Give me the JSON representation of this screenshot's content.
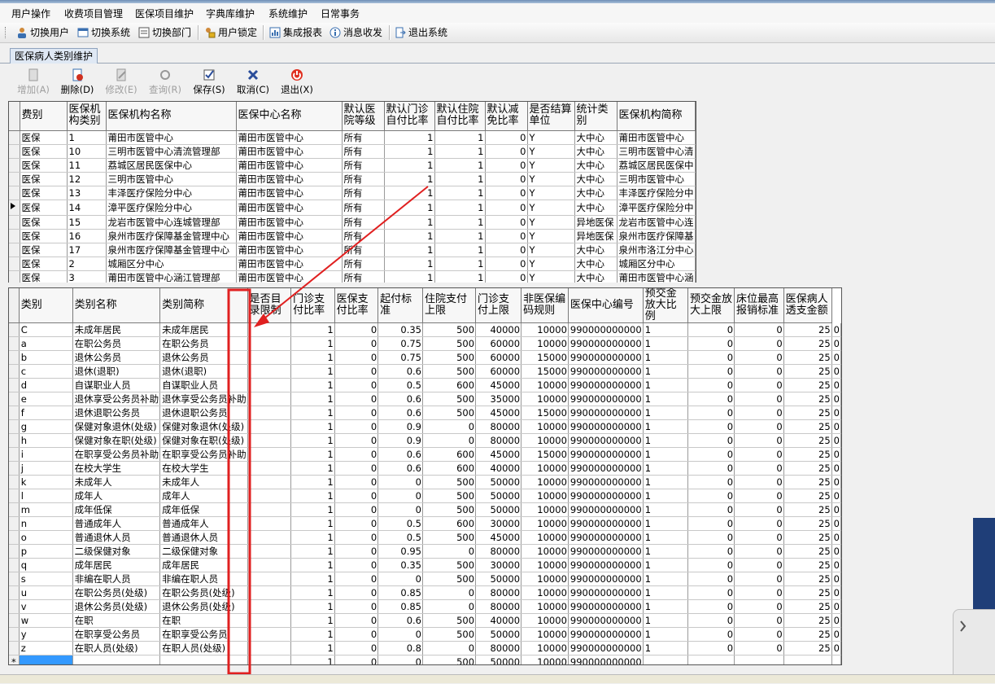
{
  "menu": [
    "用户操作",
    "收费项目管理",
    "医保项目维护",
    "字典库维护",
    "系统维护",
    "日常事务"
  ],
  "toolbar": {
    "switch_user": "切换用户",
    "switch_system": "切换系统",
    "switch_dept": "切换部门",
    "lock_user": "用户锁定",
    "reports": "集成报表",
    "messages": "消息收发",
    "exit_system": "退出系统"
  },
  "tab_title": "医保病人类别维护",
  "actions": {
    "add": "增加(A)",
    "delete": "删除(D)",
    "modify": "修改(E)",
    "query": "查询(R)",
    "save": "保存(S)",
    "cancel": "取消(C)",
    "exit": "退出(X)"
  },
  "grid1": {
    "headers": [
      "费别",
      "医保机构类别",
      "医保机构名称",
      "医保中心名称",
      "默认医院等级",
      "默认门诊自付比率",
      "默认住院自付比率",
      "默认减免比率",
      "是否结算单位",
      "统计类别",
      "医保机构简称"
    ],
    "rows": [
      [
        "医保",
        "1",
        "莆田市医管中心",
        "莆田市医管中心",
        "所有",
        "1",
        "1",
        "0",
        "Y",
        "大中心",
        "莆田市医管中心"
      ],
      [
        "医保",
        "10",
        "三明市医管中心清流管理部",
        "莆田市医管中心",
        "所有",
        "1",
        "1",
        "0",
        "Y",
        "大中心",
        "三明市医管中心清"
      ],
      [
        "医保",
        "11",
        "荔城区居民医保中心",
        "莆田市医管中心",
        "所有",
        "1",
        "1",
        "0",
        "Y",
        "大中心",
        "荔城区居民医保中"
      ],
      [
        "医保",
        "12",
        "三明市医管中心",
        "莆田市医管中心",
        "所有",
        "1",
        "1",
        "0",
        "Y",
        "大中心",
        "三明市医管中心"
      ],
      [
        "医保",
        "13",
        "丰泽医疗保险分中心",
        "莆田市医管中心",
        "所有",
        "1",
        "1",
        "0",
        "Y",
        "大中心",
        "丰泽医疗保险分中"
      ],
      [
        "医保",
        "14",
        "漳平医疗保险分中心",
        "莆田市医管中心",
        "所有",
        "1",
        "1",
        "0",
        "Y",
        "大中心",
        "漳平医疗保险分中"
      ],
      [
        "医保",
        "15",
        "龙岩市医管中心连城管理部",
        "莆田市医管中心",
        "所有",
        "1",
        "1",
        "0",
        "Y",
        "异地医保",
        "龙岩市医管中心连"
      ],
      [
        "医保",
        "16",
        "泉州市医疗保障基金管理中心",
        "莆田市医管中心",
        "所有",
        "1",
        "1",
        "0",
        "Y",
        "异地医保",
        "泉州市医疗保障基"
      ],
      [
        "医保",
        "17",
        "泉州市医疗保障基金管理中心",
        "莆田市医管中心",
        "所有",
        "1",
        "1",
        "0",
        "Y",
        "大中心",
        "泉州市洛江分中心"
      ],
      [
        "医保",
        "2",
        "城厢区分中心",
        "莆田市医管中心",
        "所有",
        "1",
        "1",
        "0",
        "Y",
        "大中心",
        "城厢区分中心"
      ],
      [
        "医保",
        "3",
        "莆田市医管中心涵江管理部",
        "莆田市医管中心",
        "所有",
        "1",
        "1",
        "0",
        "Y",
        "大中心",
        "莆田市医管中心涵"
      ]
    ],
    "current_row": 5
  },
  "grid2": {
    "headers": [
      "类别",
      "类别名称",
      "类别简称",
      "是否目录限制",
      "门诊支付比率",
      "医保支付比率",
      "起付标准",
      "住院支付上限",
      "门诊支付上限",
      "非医保编码规则",
      "医保中心编号",
      "预交金放大比例",
      "预交金放大上限",
      "床位最高报销标准",
      "医保病人透支金额"
    ],
    "rows": [
      [
        "C",
        "未成年居民",
        "未成年居民",
        "",
        "1",
        "0",
        "0.35",
        "500",
        "40000",
        "10000",
        "990000000000",
        "1",
        "0",
        "0",
        "25",
        "0"
      ],
      [
        "a",
        "在职公务员",
        "在职公务员",
        "",
        "1",
        "0",
        "0.75",
        "500",
        "60000",
        "10000",
        "990000000000",
        "1",
        "0",
        "0",
        "25",
        "0"
      ],
      [
        "b",
        "退休公务员",
        "退休公务员",
        "",
        "1",
        "0",
        "0.75",
        "500",
        "60000",
        "15000",
        "990000000000",
        "1",
        "0",
        "0",
        "25",
        "0"
      ],
      [
        "c",
        "退休(退职)",
        "退休(退职)",
        "",
        "1",
        "0",
        "0.6",
        "500",
        "60000",
        "15000",
        "990000000000",
        "1",
        "0",
        "0",
        "25",
        "0"
      ],
      [
        "d",
        "自谋职业人员",
        "自谋职业人员",
        "",
        "1",
        "0",
        "0.5",
        "600",
        "45000",
        "10000",
        "990000000000",
        "1",
        "0",
        "0",
        "25",
        "0"
      ],
      [
        "e",
        "退休享受公务员补助",
        "退休享受公务员补助",
        "",
        "1",
        "0",
        "0.6",
        "500",
        "35000",
        "10000",
        "990000000000",
        "1",
        "0",
        "0",
        "25",
        "0"
      ],
      [
        "f",
        "退休退职公务员",
        "退休退职公务员",
        "",
        "1",
        "0",
        "0.6",
        "500",
        "45000",
        "15000",
        "990000000000",
        "1",
        "0",
        "0",
        "25",
        "0"
      ],
      [
        "g",
        "保健对象退休(处级)",
        "保健对象退休(处级)",
        "",
        "1",
        "0",
        "0.9",
        "0",
        "80000",
        "10000",
        "990000000000",
        "1",
        "0",
        "0",
        "25",
        "0"
      ],
      [
        "h",
        "保健对象在职(处级)",
        "保健对象在职(处级)",
        "",
        "1",
        "0",
        "0.9",
        "0",
        "80000",
        "10000",
        "990000000000",
        "1",
        "0",
        "0",
        "25",
        "0"
      ],
      [
        "i",
        "在职享受公务员补助",
        "在职享受公务员补助",
        "",
        "1",
        "0",
        "0.6",
        "600",
        "45000",
        "15000",
        "990000000000",
        "1",
        "0",
        "0",
        "25",
        "0"
      ],
      [
        "j",
        "在校大学生",
        "在校大学生",
        "",
        "1",
        "0",
        "0.6",
        "600",
        "40000",
        "10000",
        "990000000000",
        "1",
        "0",
        "0",
        "25",
        "0"
      ],
      [
        "k",
        "未成年人",
        "未成年人",
        "",
        "1",
        "0",
        "0",
        "500",
        "50000",
        "10000",
        "990000000000",
        "1",
        "0",
        "0",
        "25",
        "0"
      ],
      [
        "l",
        "成年人",
        "成年人",
        "",
        "1",
        "0",
        "0",
        "500",
        "50000",
        "10000",
        "990000000000",
        "1",
        "0",
        "0",
        "25",
        "0"
      ],
      [
        "m",
        "成年低保",
        "成年低保",
        "",
        "1",
        "0",
        "0",
        "500",
        "50000",
        "10000",
        "990000000000",
        "1",
        "0",
        "0",
        "25",
        "0"
      ],
      [
        "n",
        "普通成年人",
        "普通成年人",
        "",
        "1",
        "0",
        "0.5",
        "600",
        "30000",
        "10000",
        "990000000000",
        "1",
        "0",
        "0",
        "25",
        "0"
      ],
      [
        "o",
        "普通退休人员",
        "普通退休人员",
        "",
        "1",
        "0",
        "0.5",
        "500",
        "45000",
        "10000",
        "990000000000",
        "1",
        "0",
        "0",
        "25",
        "0"
      ],
      [
        "p",
        "二级保健对象",
        "二级保健对象",
        "",
        "1",
        "0",
        "0.95",
        "0",
        "80000",
        "10000",
        "990000000000",
        "1",
        "0",
        "0",
        "25",
        "0"
      ],
      [
        "q",
        "成年居民",
        "成年居民",
        "",
        "1",
        "0",
        "0.35",
        "500",
        "30000",
        "10000",
        "990000000000",
        "1",
        "0",
        "0",
        "25",
        "0"
      ],
      [
        "s",
        "非编在职人员",
        "非编在职人员",
        "",
        "1",
        "0",
        "0",
        "500",
        "50000",
        "10000",
        "990000000000",
        "1",
        "0",
        "0",
        "25",
        "0"
      ],
      [
        "u",
        "在职公务员(处级)",
        "在职公务员(处级)",
        "",
        "1",
        "0",
        "0.85",
        "0",
        "80000",
        "10000",
        "990000000000",
        "1",
        "0",
        "0",
        "25",
        "0"
      ],
      [
        "v",
        "退休公务员(处级)",
        "退休公务员(处级)",
        "",
        "1",
        "0",
        "0.85",
        "0",
        "80000",
        "10000",
        "990000000000",
        "1",
        "0",
        "0",
        "25",
        "0"
      ],
      [
        "w",
        "在职",
        "在职",
        "",
        "1",
        "0",
        "0.6",
        "500",
        "40000",
        "10000",
        "990000000000",
        "1",
        "0",
        "0",
        "25",
        "0"
      ],
      [
        "y",
        "在职享受公务员",
        "在职享受公务员",
        "",
        "1",
        "0",
        "0",
        "500",
        "50000",
        "10000",
        "990000000000",
        "1",
        "0",
        "0",
        "25",
        "0"
      ],
      [
        "z",
        "在职人员(处级)",
        "在职人员(处级)",
        "",
        "1",
        "0",
        "0.8",
        "0",
        "80000",
        "10000",
        "990000000000",
        "1",
        "0",
        "0",
        "25",
        "0"
      ]
    ],
    "new_row": [
      "",
      "",
      "",
      "",
      "1",
      "0",
      "0",
      "500",
      "50000",
      "10000",
      "990000000000",
      "",
      "",
      "",
      "",
      ""
    ],
    "new_row_marker": "*"
  },
  "colors": {
    "annotation": "#e02020",
    "selection": "#3399ff",
    "menu_bg": "#f6f6f6"
  }
}
